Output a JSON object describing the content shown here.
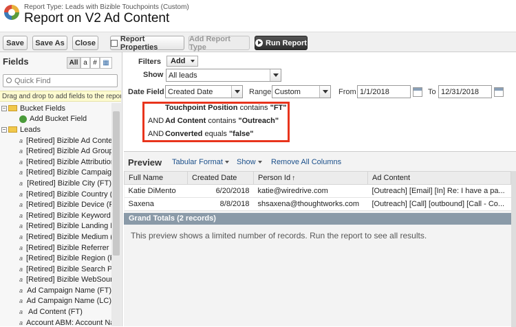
{
  "header": {
    "subtitle": "Report Type: Leads with Bizible Touchpoints (Custom)",
    "title": "Report on V2 Ad Content"
  },
  "toolbar": {
    "save": "Save",
    "save_as": "Save As",
    "close": "Close",
    "report_properties": "Report Properties",
    "add_report_type": "Add Report Type",
    "run_report": "Run Report"
  },
  "sidebar": {
    "heading": "Fields",
    "filter_buttons": [
      "All",
      "a",
      "#",
      "▦"
    ],
    "quick_find_placeholder": "Quick Find",
    "hint": "Drag and drop to add fields to the report.",
    "tree": [
      {
        "label": "Bucket Fields",
        "type": "folder"
      },
      {
        "label": "Add Bucket Field",
        "type": "add"
      },
      {
        "label": "Leads",
        "type": "folder"
      },
      {
        "label": "[Retired] Bizible Ad Content",
        "type": "field"
      },
      {
        "label": "[Retired] Bizible Ad Group (F",
        "type": "field"
      },
      {
        "label": "[Retired] Bizible Attribution: [",
        "type": "field"
      },
      {
        "label": "[Retired] Bizible Campaign (",
        "type": "field"
      },
      {
        "label": "[Retired] Bizible City (FT)",
        "type": "field"
      },
      {
        "label": "[Retired] Bizible Country (FT",
        "type": "field"
      },
      {
        "label": "[Retired] Bizible Device (FT)",
        "type": "field"
      },
      {
        "label": "[Retired] Bizible Keyword (FT",
        "type": "field"
      },
      {
        "label": "[Retired] Bizible Landing Pag",
        "type": "field"
      },
      {
        "label": "[Retired] Bizible Medium (FT",
        "type": "field"
      },
      {
        "label": "[Retired] Bizible Referrer Pa",
        "type": "field"
      },
      {
        "label": "[Retired] Bizible Region (FT)",
        "type": "field"
      },
      {
        "label": "[Retired] Bizible Search Phra",
        "type": "field"
      },
      {
        "label": "[Retired] Bizible WebSource",
        "type": "field"
      },
      {
        "label": "Ad Campaign Name (FT)",
        "type": "field"
      },
      {
        "label": "Ad Campaign Name (LC)",
        "type": "field"
      },
      {
        "label": "Ad Content (FT)",
        "type": "field"
      },
      {
        "label": "Account ABM: Account Nam",
        "type": "field"
      }
    ]
  },
  "filters": {
    "filters_label": "Filters",
    "add_label": "Add",
    "show_label": "Show",
    "show_value": "All leads",
    "date_field_label": "Date Field",
    "date_field_value": "Created Date",
    "range_label": "Range",
    "range_value": "Custom",
    "from_label": "From",
    "from_value": "1/1/2018",
    "to_label": "To",
    "to_value": "12/31/2018",
    "criteria": [
      {
        "prefix": "",
        "field": "Touchpoint Position",
        "op": "contains",
        "value": "\"FT\""
      },
      {
        "prefix": "AND",
        "field": "Ad Content",
        "op": "contains",
        "value": "\"Outreach\""
      },
      {
        "prefix": "AND",
        "field": "Converted",
        "op": "equals",
        "value": "\"false\""
      }
    ]
  },
  "preview": {
    "title": "Preview",
    "format": "Tabular Format",
    "show": "Show",
    "remove": "Remove All Columns",
    "columns": [
      "Full Name",
      "Created Date",
      "Person Id",
      "Ad Content"
    ],
    "sort_indicator": "↑",
    "rows": [
      [
        "Katie DiMento",
        "6/20/2018",
        "katie@wiredrive.com",
        "[Outreach] [Email] [In] Re: I have a pa..."
      ],
      [
        "Saxena",
        "8/8/2018",
        "shsaxena@thoughtworks.com",
        "[Outreach] [Call] [outbound] [Call - Co..."
      ]
    ],
    "grand_totals": "Grand Totals (2 records)",
    "note": "This preview shows a limited number of records. Run the report to see all results."
  }
}
